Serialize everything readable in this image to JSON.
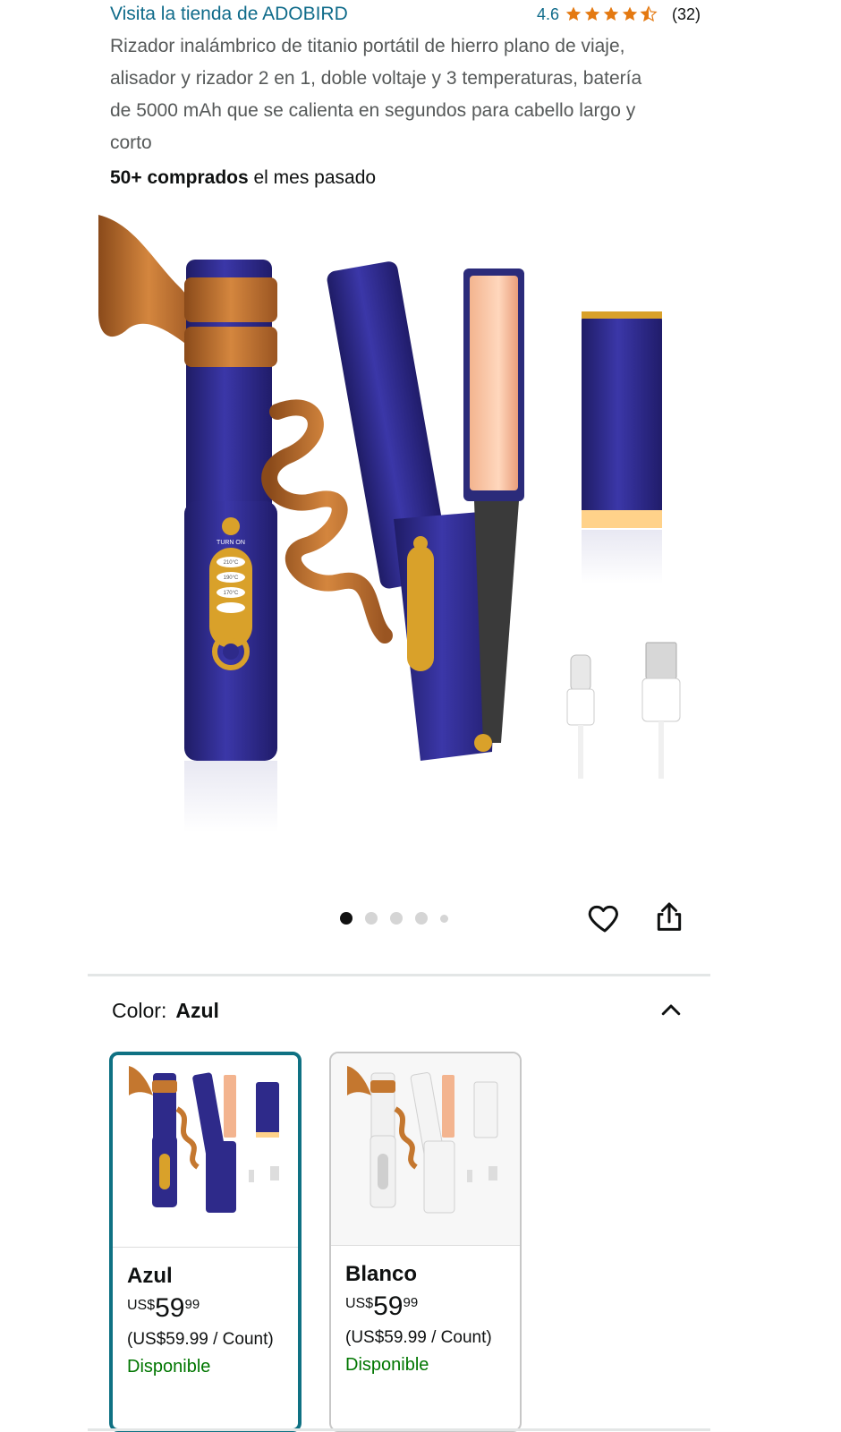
{
  "store": {
    "link_text": "Visita la tienda de ADOBIRD",
    "rating_value": "4.6",
    "rating_stars": 4.5,
    "rating_count": "(32)"
  },
  "product": {
    "title": "Rizador inalámbrico de titanio portátil de hierro plano de viaje, alisador y rizador 2 en 1, doble voltaje y 3 temperaturas, batería de 5000 mAh que se calienta en segundos para cabello largo y corto",
    "purchases_bold": "50+ comprados",
    "purchases_rest": " el mes pasado",
    "image_labels": {
      "turn_on": "TURN ON",
      "temps": [
        "210°C",
        "190°C",
        "170°C"
      ]
    }
  },
  "gallery": {
    "dot_count": 5,
    "active_index": 0
  },
  "icons": {
    "star": "star-icon",
    "heart": "heart-icon",
    "share": "share-icon",
    "chevron": "chevron-up-icon"
  },
  "variants": {
    "color_label": "Color:",
    "selected": "Azul",
    "options": [
      {
        "name": "Azul",
        "currency": "US$",
        "whole": "59",
        "fraction": "99",
        "unit_price": "(US$59.99 / Count)",
        "availability": "Disponible",
        "selected": true
      },
      {
        "name": "Blanco",
        "currency": "US$",
        "whole": "59",
        "fraction": "99",
        "unit_price": "(US$59.99 / Count)",
        "availability": "Disponible",
        "selected": false
      }
    ]
  },
  "colors": {
    "link": "#0f6b8a",
    "star": "#e47911",
    "selected_border": "#0f7183",
    "available": "#007600",
    "device_blue": "#2e2a8a",
    "device_white": "#f1f1f1",
    "gold": "#d9a12a"
  }
}
